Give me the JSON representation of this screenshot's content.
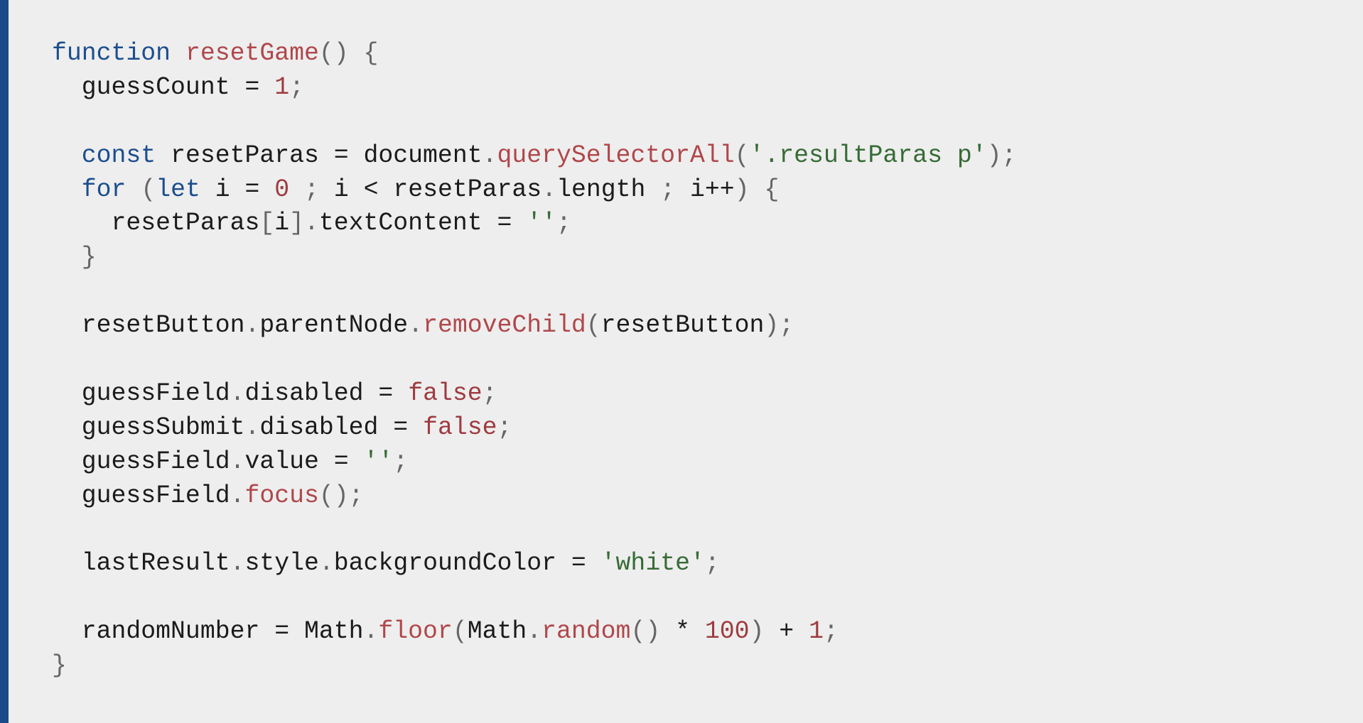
{
  "code_block": {
    "language": "javascript",
    "accent_color": "#1a4a8a",
    "background_color": "#eeeeee",
    "token_colors": {
      "keyword": "#1b4e8e",
      "function": "#b0474b",
      "number": "#9e3b3f",
      "boolean": "#9e3b3f",
      "string": "#366b35",
      "punct": "#666666",
      "plain": "#1b1b1b"
    },
    "lines": [
      [
        [
          "keyword",
          "function"
        ],
        [
          "plain",
          " "
        ],
        [
          "function",
          "resetGame"
        ],
        [
          "punct",
          "()"
        ],
        [
          "plain",
          " "
        ],
        [
          "punct",
          "{"
        ]
      ],
      [
        [
          "plain",
          "  guessCount = "
        ],
        [
          "number",
          "1"
        ],
        [
          "punct",
          ";"
        ]
      ],
      [],
      [
        [
          "plain",
          "  "
        ],
        [
          "keyword",
          "const"
        ],
        [
          "plain",
          " resetParas = document"
        ],
        [
          "punct",
          "."
        ],
        [
          "function",
          "querySelectorAll"
        ],
        [
          "punct",
          "("
        ],
        [
          "string",
          "'.resultParas p'"
        ],
        [
          "punct",
          ");"
        ]
      ],
      [
        [
          "plain",
          "  "
        ],
        [
          "keyword",
          "for"
        ],
        [
          "plain",
          " "
        ],
        [
          "punct",
          "("
        ],
        [
          "keyword",
          "let"
        ],
        [
          "plain",
          " i = "
        ],
        [
          "number",
          "0"
        ],
        [
          "plain",
          " "
        ],
        [
          "punct",
          ";"
        ],
        [
          "plain",
          " i < resetParas"
        ],
        [
          "punct",
          "."
        ],
        [
          "plain",
          "length "
        ],
        [
          "punct",
          ";"
        ],
        [
          "plain",
          " i++"
        ],
        [
          "punct",
          ")"
        ],
        [
          "plain",
          " "
        ],
        [
          "punct",
          "{"
        ]
      ],
      [
        [
          "plain",
          "    resetParas"
        ],
        [
          "punct",
          "["
        ],
        [
          "plain",
          "i"
        ],
        [
          "punct",
          "]."
        ],
        [
          "plain",
          "textContent = "
        ],
        [
          "string",
          "''"
        ],
        [
          "punct",
          ";"
        ]
      ],
      [
        [
          "plain",
          "  "
        ],
        [
          "punct",
          "}"
        ]
      ],
      [],
      [
        [
          "plain",
          "  resetButton"
        ],
        [
          "punct",
          "."
        ],
        [
          "plain",
          "parentNode"
        ],
        [
          "punct",
          "."
        ],
        [
          "function",
          "removeChild"
        ],
        [
          "punct",
          "("
        ],
        [
          "plain",
          "resetButton"
        ],
        [
          "punct",
          ");"
        ]
      ],
      [],
      [
        [
          "plain",
          "  guessField"
        ],
        [
          "punct",
          "."
        ],
        [
          "plain",
          "disabled = "
        ],
        [
          "boolean",
          "false"
        ],
        [
          "punct",
          ";"
        ]
      ],
      [
        [
          "plain",
          "  guessSubmit"
        ],
        [
          "punct",
          "."
        ],
        [
          "plain",
          "disabled = "
        ],
        [
          "boolean",
          "false"
        ],
        [
          "punct",
          ";"
        ]
      ],
      [
        [
          "plain",
          "  guessField"
        ],
        [
          "punct",
          "."
        ],
        [
          "plain",
          "value = "
        ],
        [
          "string",
          "''"
        ],
        [
          "punct",
          ";"
        ]
      ],
      [
        [
          "plain",
          "  guessField"
        ],
        [
          "punct",
          "."
        ],
        [
          "function",
          "focus"
        ],
        [
          "punct",
          "();"
        ]
      ],
      [],
      [
        [
          "plain",
          "  lastResult"
        ],
        [
          "punct",
          "."
        ],
        [
          "plain",
          "style"
        ],
        [
          "punct",
          "."
        ],
        [
          "plain",
          "backgroundColor = "
        ],
        [
          "string",
          "'white'"
        ],
        [
          "punct",
          ";"
        ]
      ],
      [],
      [
        [
          "plain",
          "  randomNumber = Math"
        ],
        [
          "punct",
          "."
        ],
        [
          "function",
          "floor"
        ],
        [
          "punct",
          "("
        ],
        [
          "plain",
          "Math"
        ],
        [
          "punct",
          "."
        ],
        [
          "function",
          "random"
        ],
        [
          "punct",
          "()"
        ],
        [
          "plain",
          " * "
        ],
        [
          "number",
          "100"
        ],
        [
          "punct",
          ")"
        ],
        [
          "plain",
          " + "
        ],
        [
          "number",
          "1"
        ],
        [
          "punct",
          ";"
        ]
      ],
      [
        [
          "punct",
          "}"
        ]
      ]
    ]
  }
}
